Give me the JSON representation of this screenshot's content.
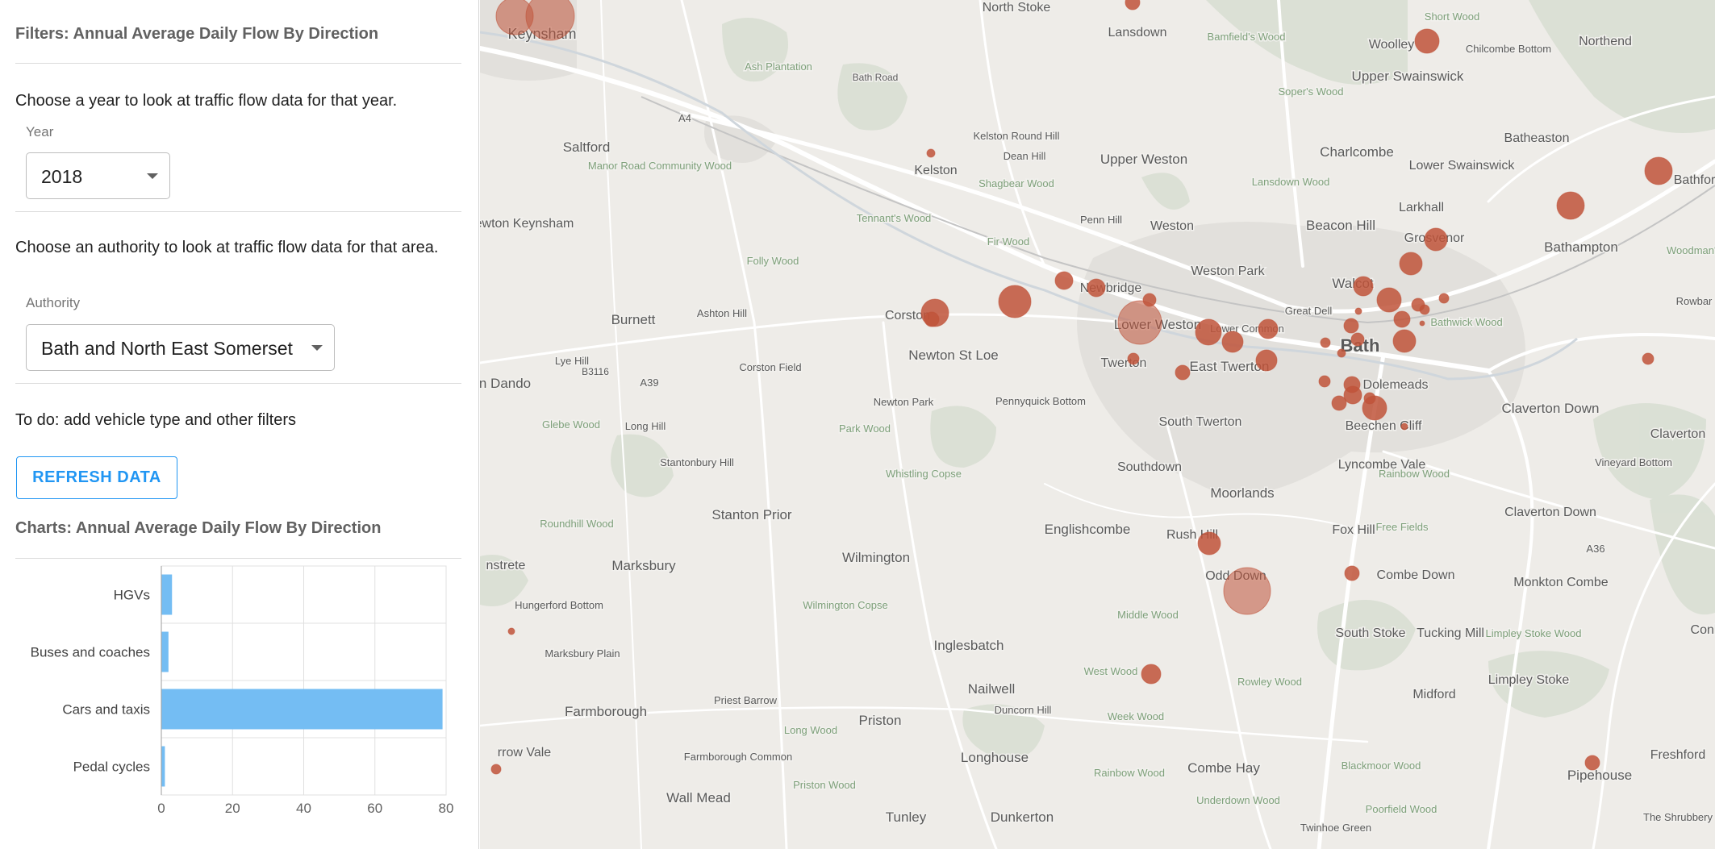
{
  "filters": {
    "header": "Filters: Annual Average Daily Flow By Direction",
    "year_help": "Choose a year to look at traffic flow data for that year.",
    "year_label": "Year",
    "year_value": "2018",
    "authority_help": "Choose an authority to look at traffic flow data for that area.",
    "authority_label": "Authority",
    "authority_value": "Bath and North East Somerset",
    "todo": "To do: add vehicle type and other filters",
    "refresh_label": "REFRESH DATA"
  },
  "charts": {
    "header": "Charts: Annual Average Daily Flow By Direction"
  },
  "chart_data": {
    "type": "bar",
    "orientation": "horizontal",
    "categories": [
      "HGVs",
      "Buses and coaches",
      "Cars and taxis",
      "Pedal cycles"
    ],
    "values": [
      3,
      2,
      79,
      1
    ],
    "xlim": [
      0,
      80
    ],
    "xticks": [
      0,
      20,
      40,
      60,
      80
    ],
    "grid": true,
    "bar_color": "#74bdf3"
  },
  "map": {
    "marker_color": "#c0543a",
    "places": [
      "North Stoke",
      "Lansdown",
      "Bamfield's Wood",
      "Woolley",
      "Short Wood",
      "Chilcombe Bottom",
      "Northend",
      "Keynsham",
      "Ash Plantation",
      "Soper's Wood",
      "Upper Swainswick",
      "Batheaston",
      "Saltford",
      "Kelston Round Hill",
      "Dean Hill",
      "Charlcombe",
      "Lower Swainswick",
      "Manor Road Community Wood",
      "Kelston",
      "Shagbear Wood",
      "Upper Weston",
      "Lansdown Wood",
      "Larkhall",
      "Bathford",
      "ewton Keynsham",
      "Tennant's Wood",
      "Penn Hill",
      "Weston",
      "Beacon Hill",
      "Grosvenor",
      "Bathampton",
      "Fir Wood",
      "Folly Wood",
      "Weston Park",
      "Walcot",
      "Woodman's",
      "Burnett",
      "Ashton Hill",
      "Corston",
      "Newbridge",
      "Great Dell",
      "Rowbar",
      "Lower Weston",
      "Lower Common",
      "Bathwick Wood",
      "Bath",
      "Lye Hill",
      "Corston Field",
      "Newton St Loe",
      "Twerton",
      "East Twerton",
      "Dolemeads",
      "n Dando",
      "Newton Park",
      "Pennyquick Bottom",
      "Claverton Down",
      "South Twerton",
      "Glebe Wood",
      "Long Hill",
      "Park Wood",
      "Beechen Cliff",
      "Claverton",
      "Vineyard Bottom",
      "Stantonbury Hill",
      "Southdown",
      "Lyncombe Vale",
      "Rainbow Wood",
      "Whistling Copse",
      "Moorlands",
      "Stanton Prior",
      "Claverton Down",
      "Roundhill Wood",
      "Englishcombe",
      "Fox Hill",
      "Free Fields",
      "Rush Hill",
      "nstrete",
      "Marksbury",
      "Wilmington",
      "Odd Down",
      "Combe Down",
      "Monkton Combe",
      "Hungerford Bottom",
      "Wilmington Copse",
      "Middle Wood",
      "South Stoke",
      "Tucking Mill",
      "Limpley Stoke Wood",
      "Conkw",
      "Marksbury Plain",
      "Inglesbatch",
      "West Wood",
      "Rowley Wood",
      "Limpley Stoke",
      "Priest Barrow",
      "Nailwell",
      "Duncorn Hill",
      "Midford",
      "Farmborough",
      "Priston",
      "Long Wood",
      "Week Wood",
      "rrow Vale",
      "Farmborough Common",
      "Longhouse",
      "Blackmoor Wood",
      "Freshford",
      "Combe Hay",
      "Priston Wood",
      "Rainbow Wood",
      "Pipehouse",
      "Wall Mead",
      "Underdown Wood",
      "Poorfield Wood",
      "Tunley",
      "Dunkerton",
      "The Shrubbery",
      "Twinhoe Green",
      "A4",
      "A39",
      "A36",
      "B3116",
      "Bath Road"
    ]
  }
}
